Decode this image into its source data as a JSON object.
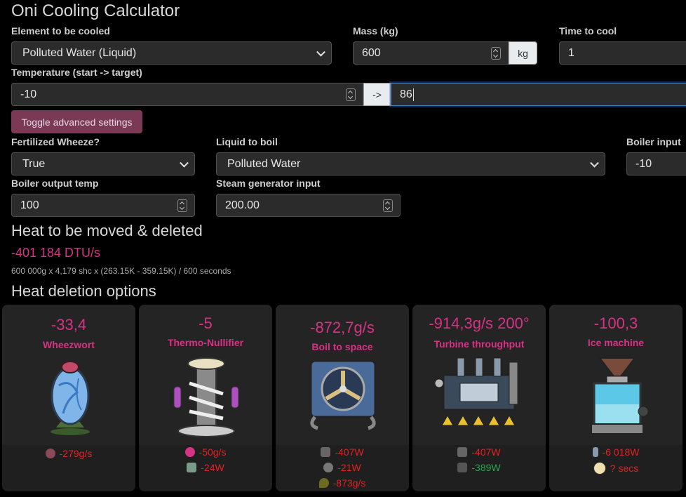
{
  "app": {
    "title": "Oni Cooling Calculator"
  },
  "form": {
    "element": {
      "label": "Element to be cooled",
      "value": "Polluted Water (Liquid)"
    },
    "mass": {
      "label": "Mass (kg)",
      "value": "600",
      "unit": "kg"
    },
    "time": {
      "label": "Time to cool",
      "value": "1"
    },
    "temperature": {
      "label": "Temperature (start -> target)",
      "start": "-10",
      "arrow": "->",
      "target": "86"
    },
    "toggle_label": "Toggle advanced settings",
    "wheeze": {
      "label": "Fertilized Wheeze?",
      "value": "True"
    },
    "liquid": {
      "label": "Liquid to boil",
      "value": "Polluted Water"
    },
    "boiler_input": {
      "label": "Boiler input",
      "value": "-10"
    },
    "boiler_output": {
      "label": "Boiler output temp",
      "value": "100"
    },
    "steam_input": {
      "label": "Steam generator input",
      "value": "200.00"
    }
  },
  "heat": {
    "title": "Heat to be moved & deleted",
    "value": "-401 184 DTU/s",
    "detail": "600 000g x 4,179 shc x (263.15K - 359.15K) / 600 seconds"
  },
  "options": {
    "title": "Heat deletion options",
    "cards": [
      {
        "value": "-33,4",
        "name": "Wheezwort",
        "stats": [
          {
            "text": "-279g/s",
            "color": "red",
            "icon": "gas-icon"
          }
        ]
      },
      {
        "value": "-5",
        "name": "Thermo-Nullifier",
        "stats": [
          {
            "text": "-50g/s",
            "color": "red",
            "icon": "hydrogen-icon"
          },
          {
            "text": "-24W",
            "color": "red",
            "icon": "power-icon"
          }
        ]
      },
      {
        "value": "-872,7g/s",
        "name": "Boil to space",
        "stats": [
          {
            "text": "-407W",
            "color": "red",
            "icon": "pump-icon"
          },
          {
            "text": "-21W",
            "color": "red",
            "icon": "fan-icon"
          },
          {
            "text": "-873g/s",
            "color": "red",
            "icon": "water-drop-icon"
          }
        ]
      },
      {
        "value": "-914,3g/s 200°",
        "name": "Turbine throughput",
        "stats": [
          {
            "text": "-407W",
            "color": "red",
            "icon": "pump-icon"
          },
          {
            "text": "-389W",
            "color": "green",
            "icon": "turbine-icon"
          }
        ]
      },
      {
        "value": "-100,3",
        "name": "Ice machine",
        "stats": [
          {
            "text": "-6 018W",
            "color": "red",
            "icon": "bottle-icon"
          },
          {
            "text": "? secs",
            "color": "red",
            "icon": "duplicant-icon"
          }
        ]
      }
    ]
  }
}
